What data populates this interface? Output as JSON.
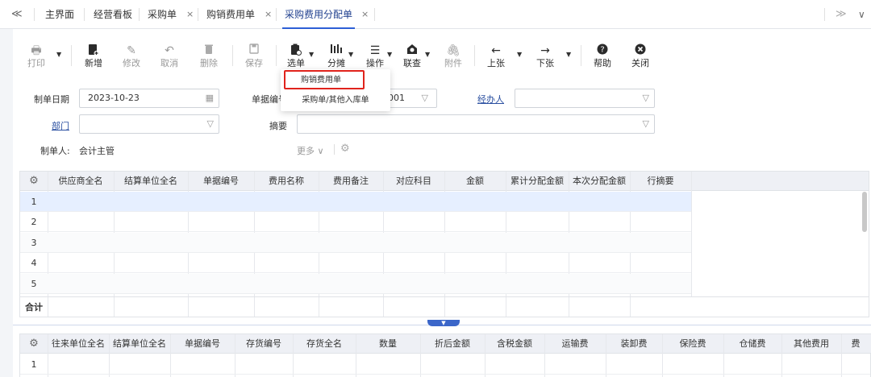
{
  "tabs": {
    "collapse_glyph": "≪",
    "items": [
      "主界面",
      "经营看板",
      "采购单",
      "购销费用单",
      "采购费用分配单"
    ],
    "close_glyph": "×",
    "more_glyph": "≫",
    "dropdown_glyph": "∨"
  },
  "toolbar": {
    "print": "打印",
    "new": "新增",
    "edit": "修改",
    "cancel": "取消",
    "delete": "删除",
    "save": "保存",
    "select": "选单",
    "split": "分摊",
    "operate": "操作",
    "link": "联查",
    "attach": "附件",
    "prev": "上张",
    "next": "下张",
    "help": "帮助",
    "close": "关闭"
  },
  "select_menu": {
    "items": [
      "购销费用单",
      "采购单/其他入库单"
    ]
  },
  "form": {
    "date_label": "制单日期",
    "date_value": "2023-10-23",
    "billno_label": "单据编号",
    "billno_value": "001",
    "handler_label": "经办人",
    "dept_label": "部门",
    "summary_label": "摘要",
    "creator_label": "制单人:",
    "creator_value": "会计主管",
    "more_label": "更多"
  },
  "grid1": {
    "columns": [
      "供应商全名",
      "结算单位全名",
      "单据编号",
      "费用名称",
      "费用备注",
      "对应科目",
      "金额",
      "累计分配金额",
      "本次分配金额",
      "行摘要"
    ],
    "rows": [
      "1",
      "2",
      "3",
      "4",
      "5"
    ],
    "total_label": "合计"
  },
  "grid2": {
    "columns": [
      "往来单位全名",
      "结算单位全名",
      "单据编号",
      "存货编号",
      "存货全名",
      "数量",
      "折后金额",
      "含税金额",
      "运输费",
      "装卸费",
      "保险费",
      "仓储费",
      "其他费用",
      "费"
    ],
    "rows": [
      "1"
    ]
  },
  "colors": {
    "accent": "#2d5fd6",
    "highlight_border": "#e0231c",
    "selected_row": "#e6efff",
    "header_bg": "#eef0f5"
  }
}
